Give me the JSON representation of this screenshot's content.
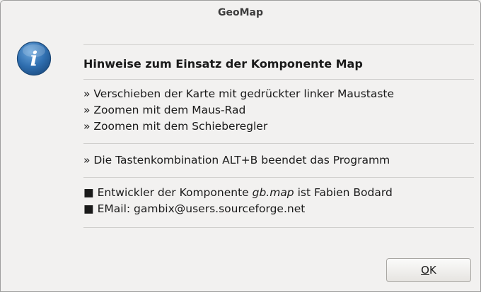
{
  "window": {
    "title": "GeoMap"
  },
  "icon": {
    "name": "info-icon",
    "glyph": "i",
    "color": "#2f6eaf"
  },
  "message": {
    "heading": "Hinweise zum Einsatz der Komponente Map",
    "usage": [
      "» Verschieben der Karte mit gedrückter linker Maustaste",
      "» Zoomen mit dem Maus-Rad",
      "» Zoomen mit dem Schieberegler"
    ],
    "exit": "» Die Tastenkombination ALT+B beendet das Programm",
    "developer": {
      "bullet": "■",
      "prefix": "Entwickler der Komponente ",
      "component": "gb.map",
      "suffix": " ist Fabien Bodard"
    },
    "email": {
      "bullet": "■",
      "text": "EMail: gambix@users.sourceforge.net"
    }
  },
  "buttons": {
    "ok_mnemonic": "O",
    "ok_rest": "K"
  }
}
